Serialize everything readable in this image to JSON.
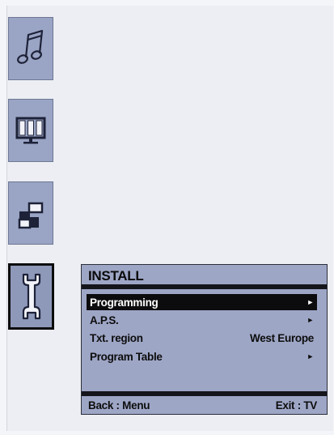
{
  "colors": {
    "background": "#eceef3",
    "tile": "#9aa4c4",
    "panel": "#9ea6c6",
    "highlight": "#0c0c0e",
    "highlight_text": "#ffffff"
  },
  "sidebar": {
    "items": [
      {
        "name": "sound",
        "icon": "music-note-icon"
      },
      {
        "name": "picture",
        "icon": "tv-screen-icon"
      },
      {
        "name": "features",
        "icon": "pip-layout-icon"
      },
      {
        "name": "install",
        "icon": "wrench-icon",
        "active": true
      }
    ]
  },
  "menu": {
    "title": "INSTALL",
    "items": [
      {
        "label": "Programming",
        "value": "►",
        "selected": true
      },
      {
        "label": "A.P.S.",
        "value": "►"
      },
      {
        "label": "Txt. region",
        "value": "West Europe"
      },
      {
        "label": "Program Table",
        "value": "►"
      }
    ],
    "footer": {
      "left": "Back : Menu",
      "right": "Exit : TV"
    }
  }
}
